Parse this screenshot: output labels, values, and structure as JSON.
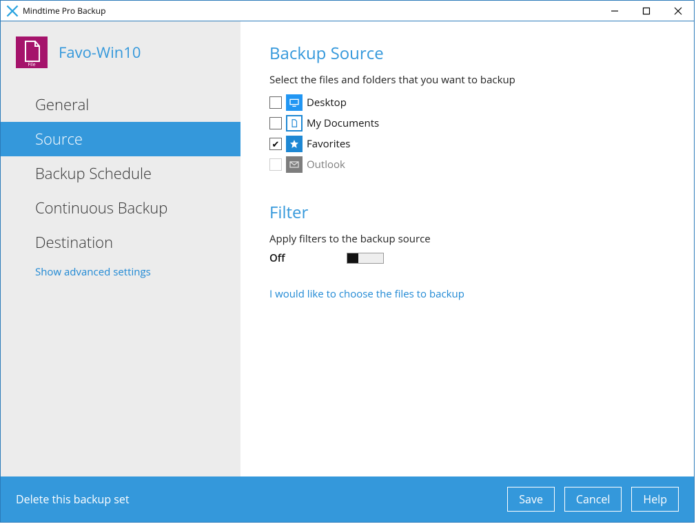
{
  "titlebar": {
    "title": "Mindtime Pro Backup"
  },
  "profile": {
    "name": "Favo-Win10",
    "icon_caption": "File"
  },
  "sidebar": {
    "items": [
      {
        "label": "General"
      },
      {
        "label": "Source"
      },
      {
        "label": "Backup Schedule"
      },
      {
        "label": "Continuous Backup"
      },
      {
        "label": "Destination"
      }
    ],
    "adv_link": "Show advanced settings"
  },
  "main": {
    "source_title": "Backup Source",
    "source_sub": "Select the files and folders that you want to backup",
    "sources": [
      {
        "label": "Desktop",
        "icon": "monitor-icon",
        "checked": false,
        "disabled": false
      },
      {
        "label": "My Documents",
        "icon": "document-icon",
        "checked": false,
        "disabled": false
      },
      {
        "label": "Favorites",
        "icon": "star-icon",
        "checked": true,
        "disabled": false
      },
      {
        "label": "Outlook",
        "icon": "mail-icon",
        "checked": false,
        "disabled": true
      }
    ],
    "filter_title": "Filter",
    "filter_sub": "Apply filters to the backup source",
    "filter_state": "Off",
    "choose_link": "I would like to choose the files to backup"
  },
  "footer": {
    "delete": "Delete this backup set",
    "save": "Save",
    "cancel": "Cancel",
    "help": "Help"
  }
}
